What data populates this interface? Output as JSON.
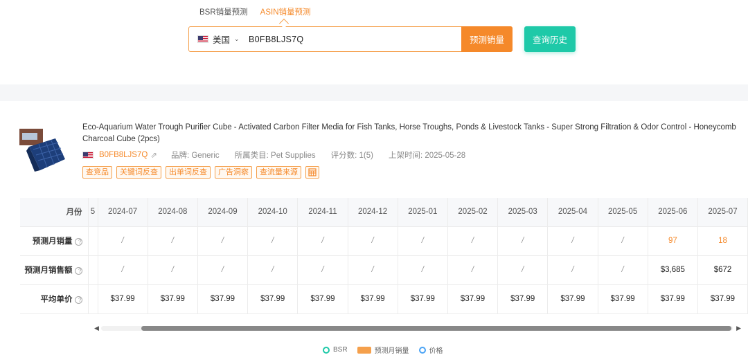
{
  "tabs": [
    {
      "label": "BSR销量预测",
      "active": false
    },
    {
      "label": "ASIN销量预测",
      "active": true
    }
  ],
  "search": {
    "country": "美国",
    "asin_value": "B0FB8LJS7Q",
    "predict_label": "预测销量",
    "history_label": "查询历史"
  },
  "product": {
    "title": "Eco-Aquarium Water Trough Purifier Cube - Activated Carbon Filter Media for Fish Tanks, Horse Troughs, Ponds & Livestock Tanks - Super Strong Filtration & Odor Control - Honeycomb Charcoal Cube (2pcs)",
    "asin": "B0FB8LJS7Q",
    "brand": "品牌: Generic",
    "category": "所属类目: Pet Supplies",
    "rating": "评分数: 1(5)",
    "listed": "上架时间: 2025-05-28",
    "tags": [
      "查竞品",
      "关键词反查",
      "出单词反查",
      "广告洞察",
      "查流量来源"
    ]
  },
  "table": {
    "month_label": "月份",
    "months": [
      "2024-07",
      "2024-08",
      "2024-09",
      "2024-10",
      "2024-11",
      "2024-12",
      "2025-01",
      "2025-02",
      "2025-03",
      "2025-04",
      "2025-05",
      "2025-06",
      "2025-07"
    ],
    "rows": [
      {
        "label": "预测月销量",
        "values": [
          "/",
          "/",
          "/",
          "/",
          "/",
          "/",
          "/",
          "/",
          "/",
          "/",
          "/",
          "97",
          "18"
        ]
      },
      {
        "label": "预测月销售额",
        "values": [
          "/",
          "/",
          "/",
          "/",
          "/",
          "/",
          "/",
          "/",
          "/",
          "/",
          "/",
          "$3,685",
          "$672"
        ]
      },
      {
        "label": "平均单价",
        "values": [
          "$37.99",
          "$37.99",
          "$37.99",
          "$37.99",
          "$37.99",
          "$37.99",
          "$37.99",
          "$37.99",
          "$37.99",
          "$37.99",
          "$37.99",
          "$37.99",
          "$37.99"
        ]
      }
    ]
  },
  "legend": [
    "BSR",
    "预测月销量",
    "价格"
  ],
  "colors": {
    "accent": "#f5892a",
    "teal": "#1ec9a8"
  }
}
